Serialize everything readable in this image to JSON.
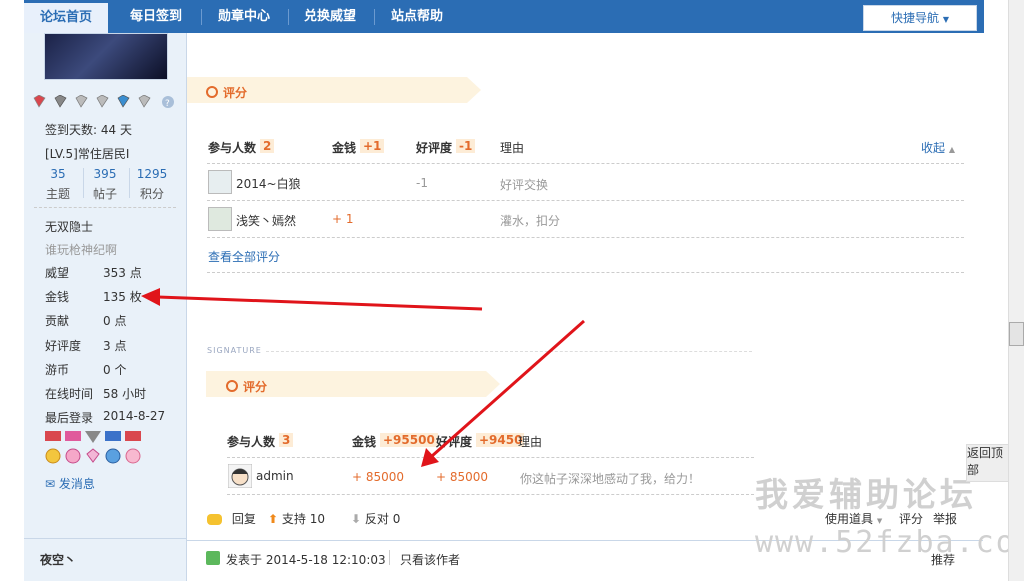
{
  "nav": {
    "tabs": [
      "论坛首页",
      "每日签到",
      "勋章中心",
      "兑换威望",
      "站点帮助"
    ],
    "quick_nav": "快捷导航"
  },
  "profile": {
    "checkin_days": "签到天数: 44 天",
    "level": "[LV.5]常住居民I",
    "stats": [
      {
        "value": "35",
        "label": "主题"
      },
      {
        "value": "395",
        "label": "帖子"
      },
      {
        "value": "1295",
        "label": "积分"
      }
    ],
    "title": "无双隐士",
    "subtitle": "谁玩枪神纪啊",
    "fields": [
      {
        "label": "威望",
        "value": "353 点"
      },
      {
        "label": "金钱",
        "value": "135 枚"
      },
      {
        "label": "贡献",
        "value": "0 点"
      },
      {
        "label": "好评度",
        "value": "3 点"
      },
      {
        "label": "游币",
        "value": "0 个"
      },
      {
        "label": "在线时间",
        "value": "58 小时"
      },
      {
        "label": "最后登录",
        "value": "2014-8-27"
      }
    ],
    "send_message": "发消息",
    "next_user": "夜空丶"
  },
  "rating1": {
    "title": "评分",
    "headers": {
      "participants": "参与人数",
      "participants_count": "2",
      "money": "金钱",
      "money_total": "+1",
      "rep": "好评度",
      "rep_total": "-1",
      "reason": "理由",
      "collapse": "收起"
    },
    "rows": [
      {
        "user": "2014~白狼",
        "money": "",
        "rep": "-1",
        "reason": "好评交换"
      },
      {
        "user": "浅笑丶嫣然",
        "money": "+ 1",
        "rep": "",
        "reason": "灌水，扣分"
      }
    ],
    "view_all": "查看全部评分"
  },
  "signature_label": "SIGNATURE",
  "rating2": {
    "title": "评分",
    "headers": {
      "participants": "参与人数",
      "participants_count": "3",
      "money": "金钱",
      "money_total": "+95500",
      "rep": "好评度",
      "rep_total": "+9450",
      "reason": "理由"
    },
    "rows": [
      {
        "user": "admin",
        "money": "+ 85000",
        "rep": "+ 85000",
        "reason": "你这帖子深深地感动了我，给力！"
      }
    ]
  },
  "actions": {
    "reply": "回复",
    "support": "支持 10",
    "oppose": "反对 0",
    "tools": "使用道具",
    "rate": "评分",
    "report": "举报"
  },
  "post_meta": {
    "posted": "发表于 2014-5-18 12:10:03",
    "only_author": "只看该作者",
    "recommend": "推荐"
  },
  "back_to_top": "返回顶部",
  "watermark": {
    "cn": "我爱辅助论坛",
    "url": "www.52fzba.com"
  }
}
